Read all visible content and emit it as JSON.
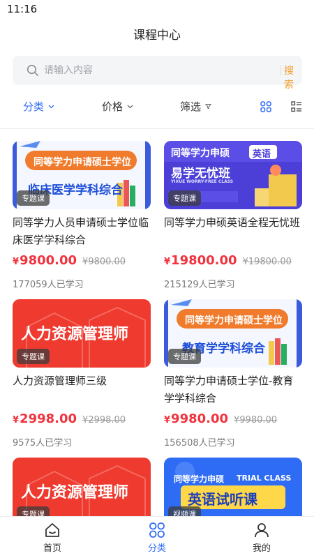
{
  "status_bar": {
    "time": "11:16"
  },
  "header": {
    "title": "课程中心"
  },
  "search": {
    "placeholder": "请输入内容",
    "button_label": "搜索"
  },
  "filters": {
    "category_label": "分类",
    "price_label": "价格",
    "screen_label": "筛选"
  },
  "courses": [
    {
      "title": "同等学力人员申请硕士学位临床医学学科综合",
      "tag": "专题课",
      "price": "9800.00",
      "original_price": "9800.00",
      "learners": "177059人已学习",
      "banner": {
        "line1": "同等学力申请硕士学位",
        "line2": "临床医学学科综合"
      }
    },
    {
      "title": "同等学力申硕英语全程无忧班",
      "tag": "专题课",
      "price": "19800.00",
      "original_price": "19800.00",
      "learners": "215129人已学习",
      "banner": {
        "line1": "同等学力申硕",
        "badge": "英语",
        "line2": "易学无忧班",
        "sub": "YIXUE WORRY-FREE CLASS"
      }
    },
    {
      "title": "人力资源管理师三级",
      "tag": "专题课",
      "price": "2998.00",
      "original_price": "2998.00",
      "learners": "9575人已学习",
      "banner": {
        "line1": "人力资源管理师"
      }
    },
    {
      "title": "同等学力申请硕士学位-教育学学科综合",
      "tag": "专题课",
      "price": "9980.00",
      "original_price": "9980.00",
      "learners": "156508人已学习",
      "banner": {
        "line1": "同等学力申请硕士学位",
        "line2": "教育学学科综合"
      }
    },
    {
      "title": "",
      "tag": "专题课",
      "banner": {
        "line1": "人力资源管理师"
      }
    },
    {
      "title": "",
      "tag": "视频课",
      "banner": {
        "line1": "同等学力申硕",
        "sub": "TRIAL CLASS",
        "line2": "英语试听课"
      }
    }
  ],
  "currency_symbol": "¥",
  "tab_bar": {
    "home": "首页",
    "category": "分类",
    "mine": "我的"
  },
  "colors": {
    "accent": "#2f6cf6",
    "price": "#f0333e",
    "search_button": "#f0a030"
  }
}
